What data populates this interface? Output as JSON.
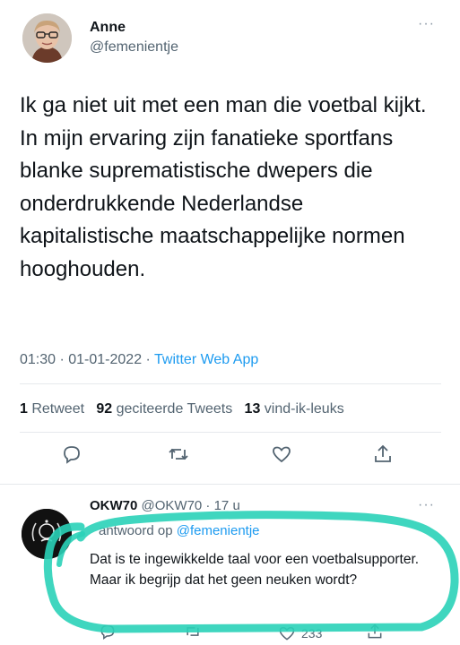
{
  "tweet": {
    "author_name": "Anne",
    "author_handle": "@femenientje",
    "more_label": "···",
    "text": "Ik ga niet uit met een man die voetbal kijkt. In mijn ervaring zijn fanatieke sportfans blanke suprematistische dwepers die onderdrukkende Nederlandse kapitalistische maatschappelijke normen hooghouden.",
    "time": "01:30 · 01-01-2022 · ",
    "source": "Twitter Web App",
    "stats": {
      "retweets_count": "1",
      "retweets_label": " Retweet",
      "quotes_count": "92",
      "quotes_label": " geciteerde Tweets",
      "likes_count": "13",
      "likes_label": " vind-ik-leuks"
    },
    "actions": [
      "reply-icon",
      "retweet-icon",
      "like-icon",
      "share-icon"
    ]
  },
  "reply": {
    "author_name": "OKW70",
    "author_handle": "@OKW70 · 17 u",
    "more_label": "···",
    "reply_to_prefix": "antwoord op ",
    "reply_to_handle": "@femenientje",
    "text": "Dat is te ingewikkelde taal voor een voetbalsupporter. Maar ik begrijp dat het geen neuken wordt?",
    "like_count": "233"
  },
  "colors": {
    "text": "#0f1419",
    "secondary": "#536471",
    "link": "#1d9bf0",
    "highlight": "#2ad1b8"
  }
}
